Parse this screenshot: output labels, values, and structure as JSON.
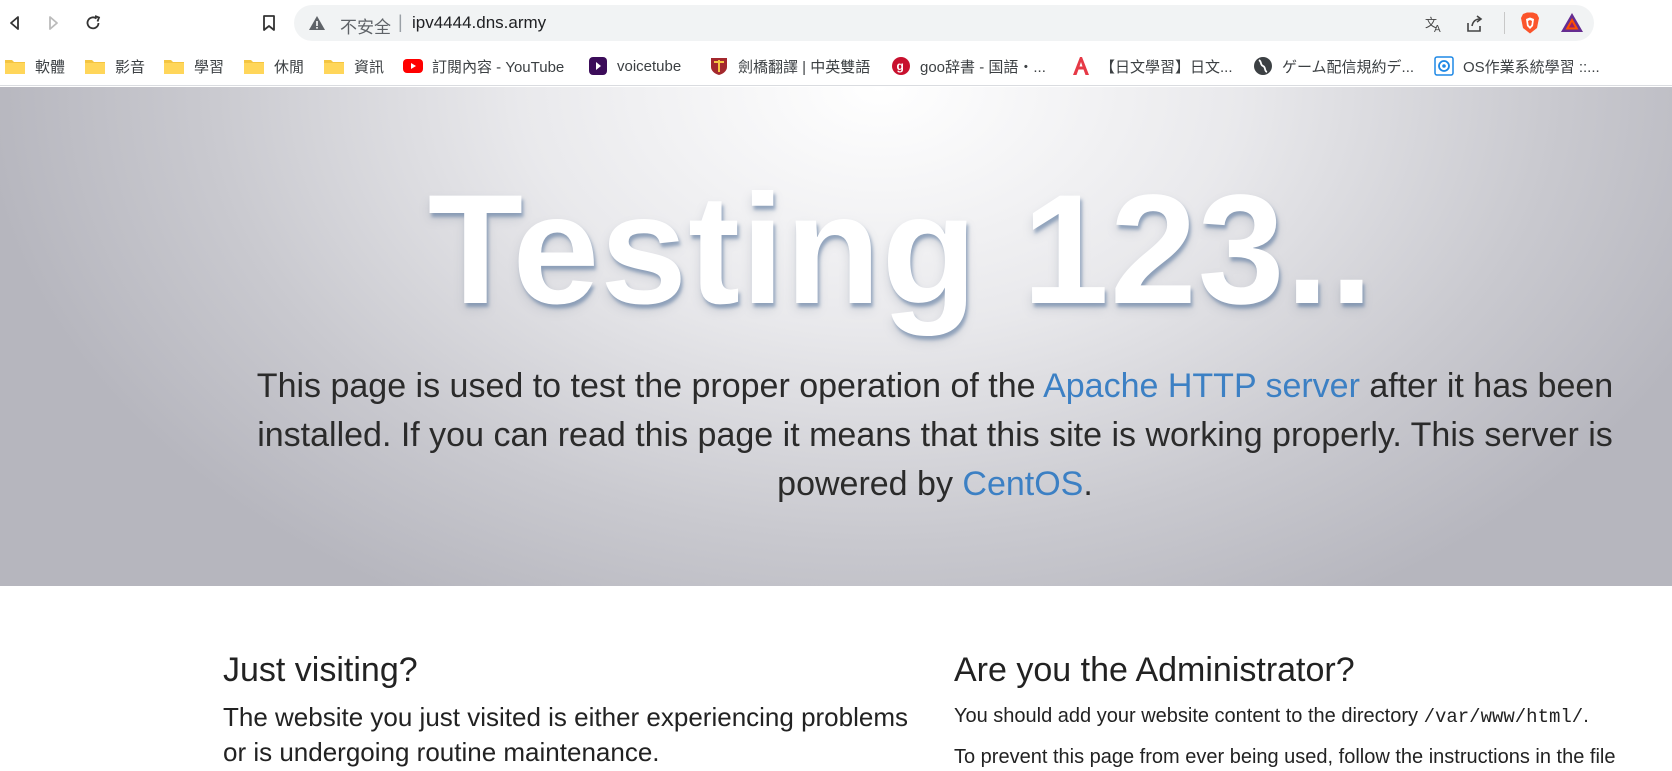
{
  "browser": {
    "security_label": "不安全",
    "separator": "|",
    "url": "ipv4444.dns.army"
  },
  "bookmarks": [
    {
      "label": "軟體",
      "icon": "folder-icon"
    },
    {
      "label": "影音",
      "icon": "folder-icon"
    },
    {
      "label": "學習",
      "icon": "folder-icon"
    },
    {
      "label": "休閒",
      "icon": "folder-icon"
    },
    {
      "label": "資訊",
      "icon": "folder-icon"
    },
    {
      "label": "訂閱內容 - YouTube",
      "icon": "youtube-icon"
    },
    {
      "label": "voicetube",
      "icon": "voicetube-icon"
    },
    {
      "label": "劍橋翻譯 | 中英雙語",
      "icon": "cambridge-icon"
    },
    {
      "label": "goo辞書 - 国語・...",
      "icon": "goo-icon"
    },
    {
      "label": "【日文學習】日文...",
      "icon": "a-letter-icon"
    },
    {
      "label": "ゲーム配信規約デ...",
      "icon": "globe-icon"
    },
    {
      "label": "OS作業系統學習 ::...",
      "icon": "os-icon"
    }
  ],
  "hero": {
    "title": "Testing 123..",
    "text_before": "This page is used to test the proper operation of the ",
    "link1": "Apache HTTP server",
    "text_middle": " after it has been installed. If you can read this page it means that this site is working properly. This server is powered by ",
    "link2": "CentOS",
    "text_after": "."
  },
  "left": {
    "heading": "Just visiting?",
    "paragraph": "The website you just visited is either experiencing problems or is undergoing routine maintenance."
  },
  "right": {
    "heading": "Are you the Administrator?",
    "p1_before": "You should add your website content to the directory ",
    "p1_code": "/var/www/html/",
    "p1_after": ".",
    "p2": "To prevent this page from ever being used, follow the instructions in the file"
  },
  "colors": {
    "link": "#3c80c4",
    "brave": "#fb542b"
  }
}
